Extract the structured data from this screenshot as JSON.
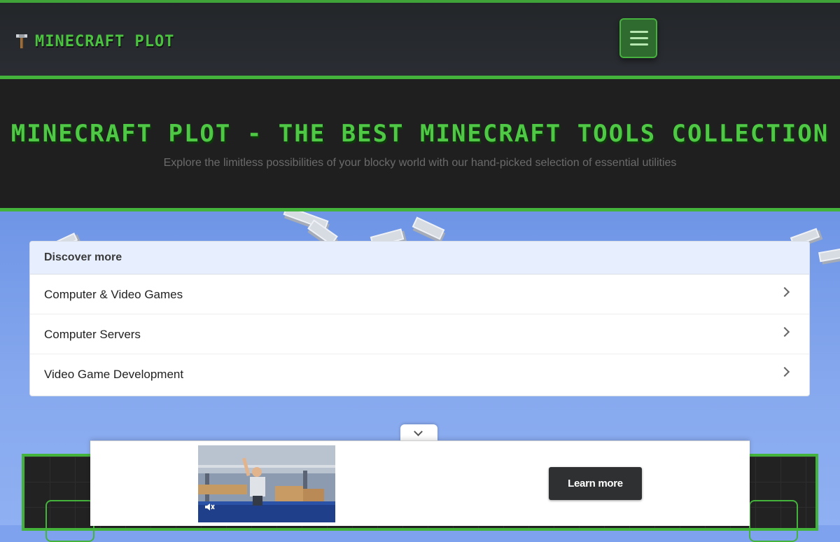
{
  "header": {
    "brand_name": "MINECRAFT PLOT",
    "brand_icon": "pickaxe-icon",
    "menu_icon": "hamburger-menu-icon",
    "accent_color": "#43b33b"
  },
  "hero": {
    "title": "MINECRAFT PLOT - THE BEST MINECRAFT TOOLS COLLECTION",
    "subtitle": "Explore the limitless possibilities of your blocky world with our hand-picked selection of essential utilities"
  },
  "discover": {
    "heading": "Discover more",
    "items": [
      {
        "label": "Computer & Video Games",
        "icon": "chevron-right-icon"
      },
      {
        "label": "Computer Servers",
        "icon": "chevron-right-icon"
      },
      {
        "label": "Video Game Development",
        "icon": "chevron-right-icon"
      }
    ]
  },
  "ad": {
    "collapse_icon": "chevron-down-icon",
    "mute_icon": "muted-speaker-icon",
    "cta_label": "Learn more"
  }
}
